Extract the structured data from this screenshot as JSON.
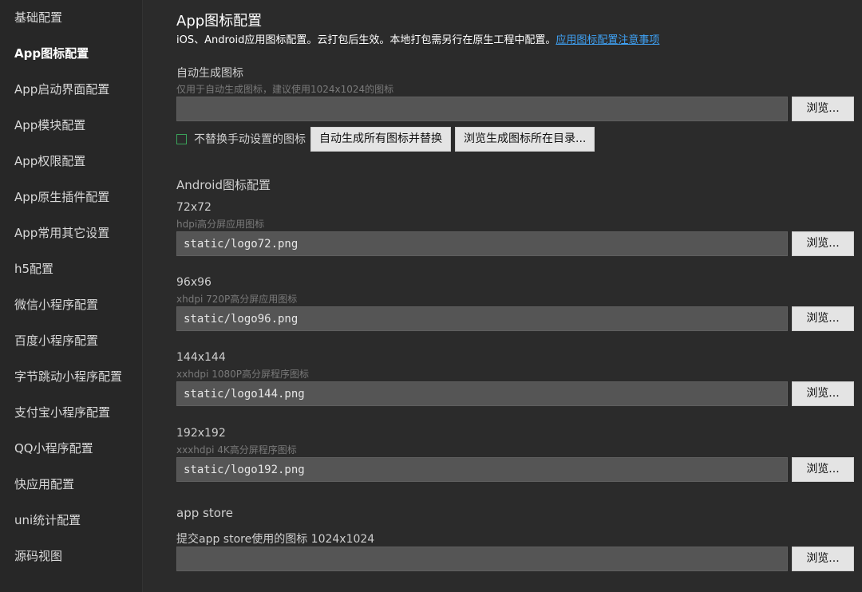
{
  "sidebar": {
    "items": [
      {
        "label": "基础配置"
      },
      {
        "label": "App图标配置"
      },
      {
        "label": "App启动界面配置"
      },
      {
        "label": "App模块配置"
      },
      {
        "label": "App权限配置"
      },
      {
        "label": "App原生插件配置"
      },
      {
        "label": "App常用其它设置"
      },
      {
        "label": "h5配置"
      },
      {
        "label": "微信小程序配置"
      },
      {
        "label": "百度小程序配置"
      },
      {
        "label": "字节跳动小程序配置"
      },
      {
        "label": "支付宝小程序配置"
      },
      {
        "label": "QQ小程序配置"
      },
      {
        "label": "快应用配置"
      },
      {
        "label": "uni统计配置"
      },
      {
        "label": "源码视图"
      }
    ],
    "active_index": 1
  },
  "header": {
    "title": "App图标配置",
    "description": "iOS、Android应用图标配置。云打包后生效。本地打包需另行在原生工程中配置。",
    "link_label": "应用图标配置注意事项"
  },
  "auto_generate": {
    "label": "自动生成图标",
    "hint": "仅用于自动生成图标，建议使用1024x1024的图标",
    "value": "",
    "browse_label": "浏览...",
    "checkbox_label": "不替换手动设置的图标",
    "checkbox_checked": false,
    "generate_label": "自动生成所有图标并替换",
    "open_dir_label": "浏览生成图标所在目录..."
  },
  "android": {
    "section_title": "Android图标配置",
    "icons": [
      {
        "size": "72x72",
        "hint": "hdpi高分屏应用图标",
        "value": "static/logo72.png",
        "browse_label": "浏览..."
      },
      {
        "size": "96x96",
        "hint": "xhdpi 720P高分屏应用图标",
        "value": "static/logo96.png",
        "browse_label": "浏览..."
      },
      {
        "size": "144x144",
        "hint": "xxhdpi 1080P高分屏程序图标",
        "value": "static/logo144.png",
        "browse_label": "浏览..."
      },
      {
        "size": "192x192",
        "hint": "xxxhdpi 4K高分屏程序图标",
        "value": "static/logo192.png",
        "browse_label": "浏览..."
      }
    ]
  },
  "app_store": {
    "section_title": "app store",
    "label": "提交app store使用的图标 1024x1024",
    "value": "",
    "browse_label": "浏览..."
  },
  "colors": {
    "background": "#2b2b2b",
    "sidebar_bg": "#272727",
    "input_bg": "#555555",
    "button_bg": "#e4e4e4",
    "link": "#3fa2f5",
    "checkbox_border": "#3aa35a"
  }
}
